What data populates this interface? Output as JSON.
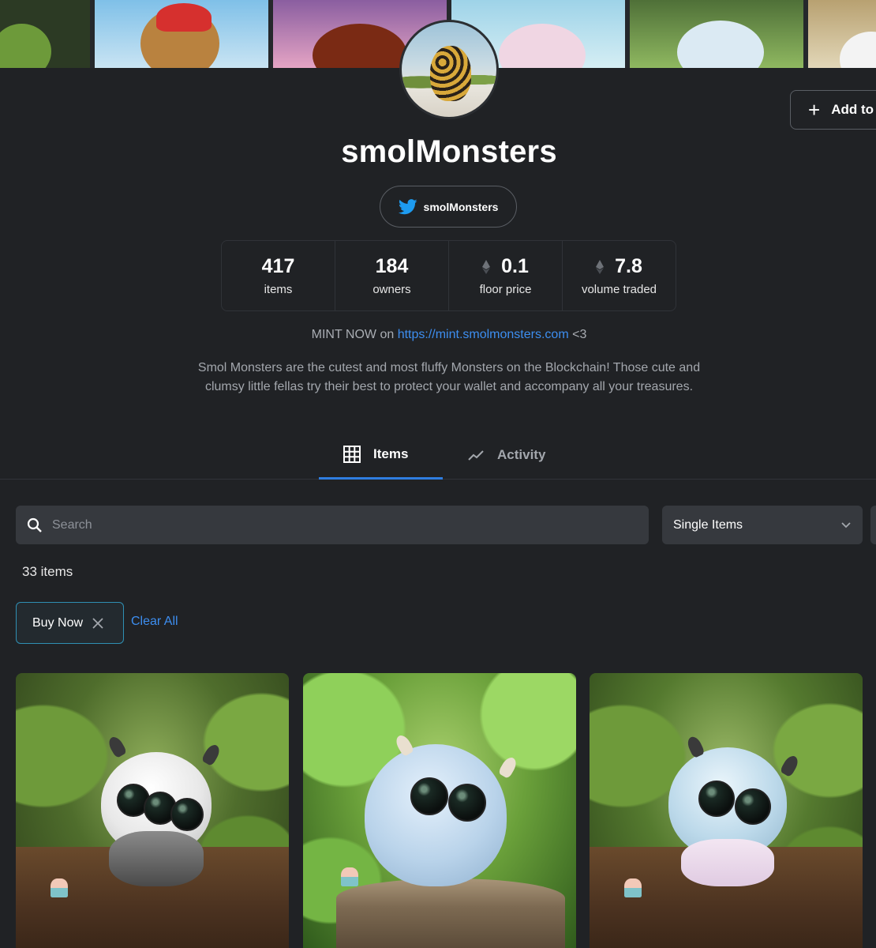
{
  "collection": {
    "title": "smolMonsters",
    "twitter_handle": "smolMonsters",
    "add_button_label": "Add to",
    "stats": [
      {
        "value": "417",
        "label": "items",
        "eth": false
      },
      {
        "value": "184",
        "label": "owners",
        "eth": false
      },
      {
        "value": "0.1",
        "label": "floor price",
        "eth": true
      },
      {
        "value": "7.8",
        "label": "volume traded",
        "eth": true
      }
    ],
    "mint_prefix": "MINT NOW on ",
    "mint_link": "https://mint.smolmonsters.com",
    "mint_suffix": " <3",
    "description_line1": "Smol Monsters are the cutest and most fluffy Monsters on the Blockchain! Those cute and",
    "description_line2": "clumsy little fellas try their best to protect your wallet and accompany all your treasures."
  },
  "tabs": {
    "items_label": "Items",
    "activity_label": "Activity",
    "active": "Items"
  },
  "filters": {
    "search_placeholder": "Search",
    "search_value": "",
    "select_value": "Single Items",
    "item_count": "33 items",
    "active_chip": "Buy Now",
    "clear_all": "Clear All"
  },
  "icons": {
    "add": "plus-icon",
    "twitter": "twitter-bird-icon",
    "eth": "ethereum-icon",
    "items_tab": "grid-icon",
    "activity_tab": "trend-line-icon",
    "search": "search-icon",
    "dropdown": "chevron-down-icon",
    "chip_remove": "close-icon"
  },
  "colors": {
    "background": "#202225",
    "accent": "#3d8ef0",
    "tab_underline": "#2f7de0",
    "chip_border": "#2f8fb3",
    "input_bg": "#36393e"
  }
}
